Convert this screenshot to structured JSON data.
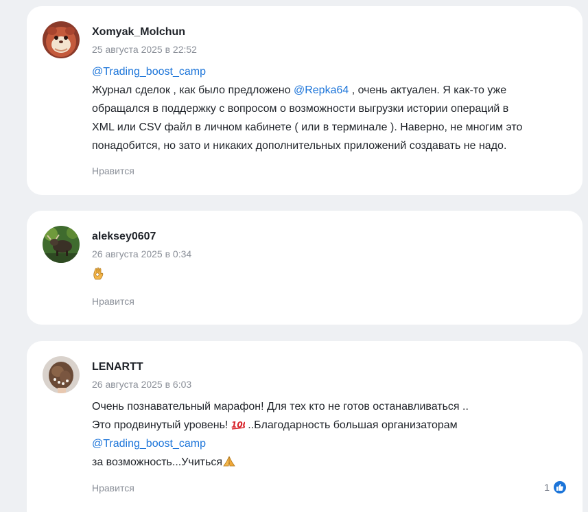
{
  "comments": [
    {
      "author": "Xomyak_Molchun",
      "date": "25 августа 2025 в 22:52",
      "avatar": "hamster-avatar",
      "mention_top": "@Trading_boost_camp",
      "line1_a": "Журнал сделок , как было предложено ",
      "line1_mention": "@Repka64",
      "line1_b": " , очень актуален. Я как-то уже",
      "line2": "обращался в поддержку   с вопросом о возможности выгрузки истории операций в",
      "line3": "XML или CSV файл в личном кабинете ( или в терминале ). Наверно, не многим это",
      "line4": "понадобится, но зато и никаких дополнительных приложений создавать не надо.",
      "like_label": "Нравится"
    },
    {
      "author": "aleksey0607",
      "date": "26 августа 2025 в 0:34",
      "avatar": "bull-avatar",
      "emoji": "ok-hand-emoji",
      "like_label": "Нравится"
    },
    {
      "author": "LENARTT",
      "date": "26 августа 2025 в 6:03",
      "avatar": "hairstyle-avatar",
      "line1": "Очень познавательный марафон! Для тех кто не готов останавливаться ..",
      "line2_a": "Это продвинутый уровень! ",
      "line2_emoji": "hundred-points-emoji",
      "line2_b": " ..Благодарность  большая организаторам",
      "line3_mention": "@Trading_boost_camp",
      "line4_a": "за возможность...Учиться",
      "line4_emoji": "folded-hands-emoji",
      "like_label": "Нравится",
      "reaction_count": "1",
      "reaction_icon": "thumbs-up-icon"
    }
  ],
  "colors": {
    "background": "#eef0f3",
    "card": "#ffffff",
    "mention": "#1b74d9",
    "muted": "#8a8f98",
    "reaction": "#1b74d9"
  }
}
